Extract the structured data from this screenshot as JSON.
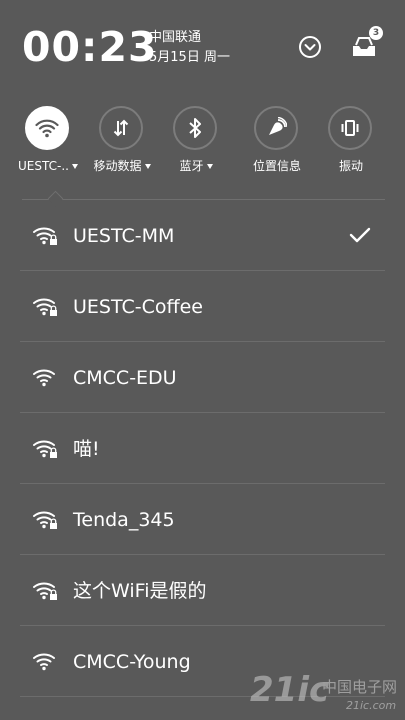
{
  "status": {
    "time": "00:23",
    "carrier": "中国联通",
    "date": "5月15日 周一",
    "notification_count": "3"
  },
  "toggles": [
    {
      "label": "UESTC-..",
      "icon": "wifi-icon",
      "active": true,
      "has_dropdown": true
    },
    {
      "label": "移动数据",
      "icon": "mobile-data-icon",
      "active": false,
      "has_dropdown": true
    },
    {
      "label": "蓝牙",
      "icon": "bluetooth-icon",
      "active": false,
      "has_dropdown": true
    },
    {
      "label": "位置信息",
      "icon": "location-icon",
      "active": false,
      "has_dropdown": false
    },
    {
      "label": "振动",
      "icon": "vibrate-icon",
      "active": false,
      "has_dropdown": false
    }
  ],
  "wifi_networks": [
    {
      "name": "UESTC-MM",
      "locked": true,
      "connected": true
    },
    {
      "name": "UESTC-Coffee",
      "locked": true,
      "connected": false
    },
    {
      "name": "CMCC-EDU",
      "locked": false,
      "connected": false
    },
    {
      "name": "喵!",
      "locked": true,
      "connected": false
    },
    {
      "name": "Tenda_345",
      "locked": true,
      "connected": false
    },
    {
      "name": "这个WiFi是假的",
      "locked": true,
      "connected": false
    },
    {
      "name": "CMCC-Young",
      "locked": false,
      "connected": false
    }
  ],
  "watermark": {
    "main": "21ic",
    "cn": "中国电子网",
    "sub": "21ic.com"
  },
  "colors": {
    "background": "#595959",
    "foreground": "#ffffff",
    "divider": "#6c6c6c"
  }
}
